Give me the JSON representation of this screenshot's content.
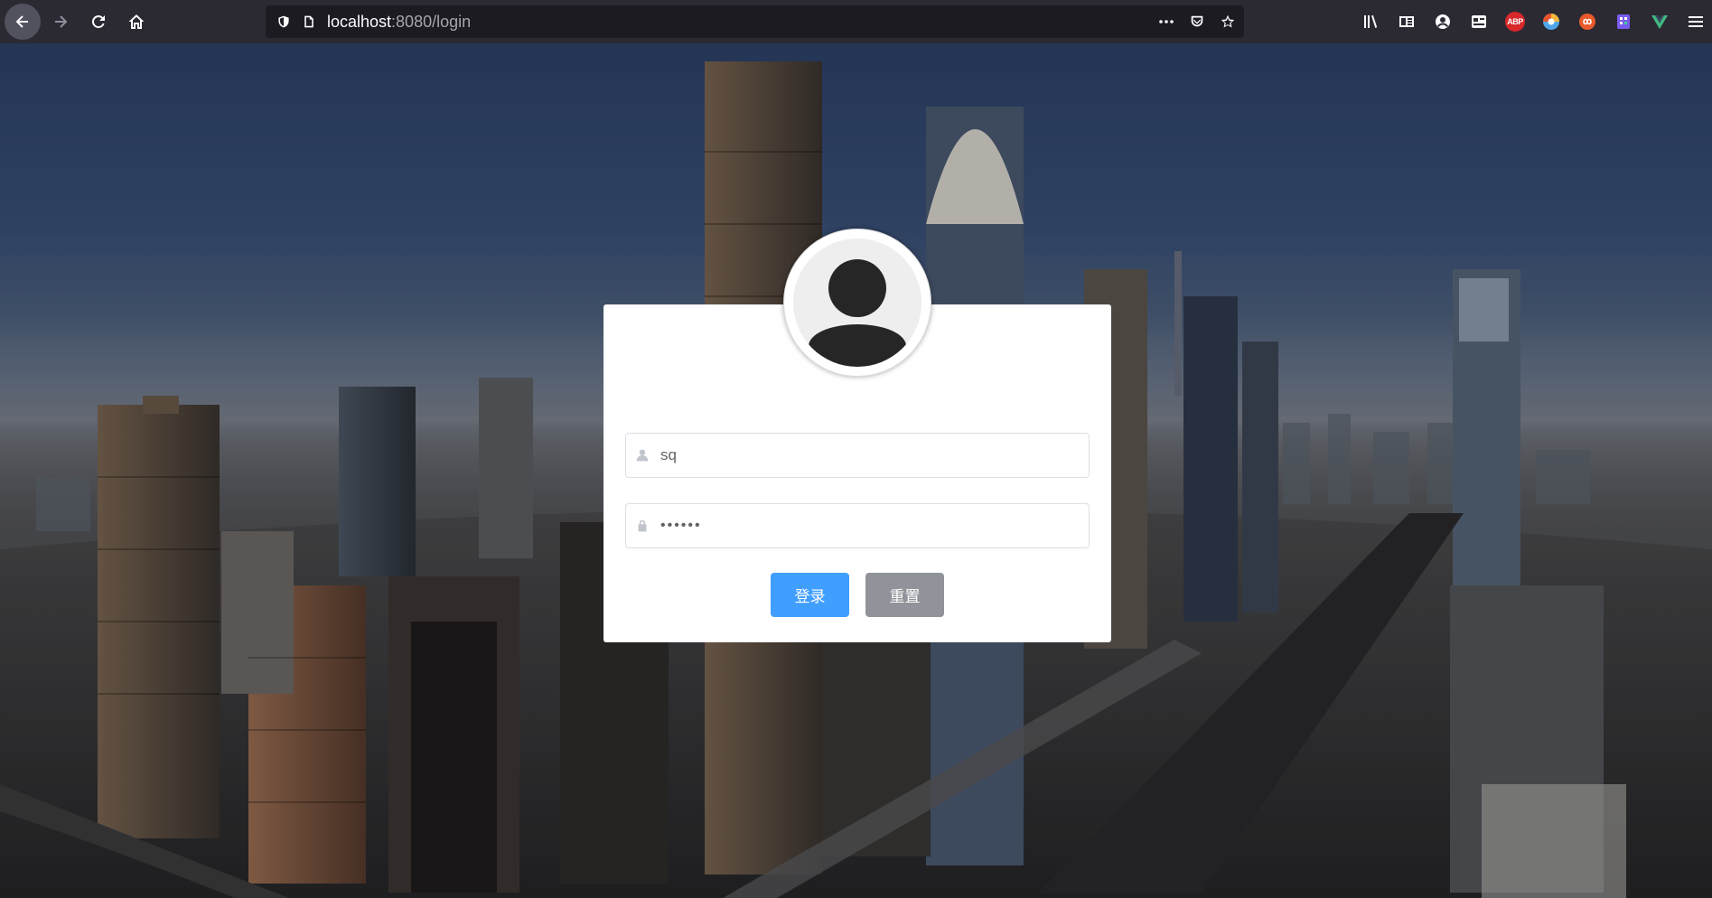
{
  "browser": {
    "url_host": "localhost",
    "url_rest": ":8080/login",
    "extensions": [
      "library-icon",
      "reader-view-icon",
      "account-icon",
      "container-icon",
      "adblock-plus-icon",
      "color-picker-icon",
      "infinity-icon",
      "extension-icon",
      "vue-devtools-icon",
      "menu-icon"
    ],
    "abp_label": "ABP"
  },
  "login": {
    "username_value": "sq",
    "password_value": "••••••",
    "login_label": "登录",
    "reset_label": "重置"
  },
  "colors": {
    "primary": "#409eff",
    "info": "#909399",
    "toolbar": "#2b2a33"
  }
}
